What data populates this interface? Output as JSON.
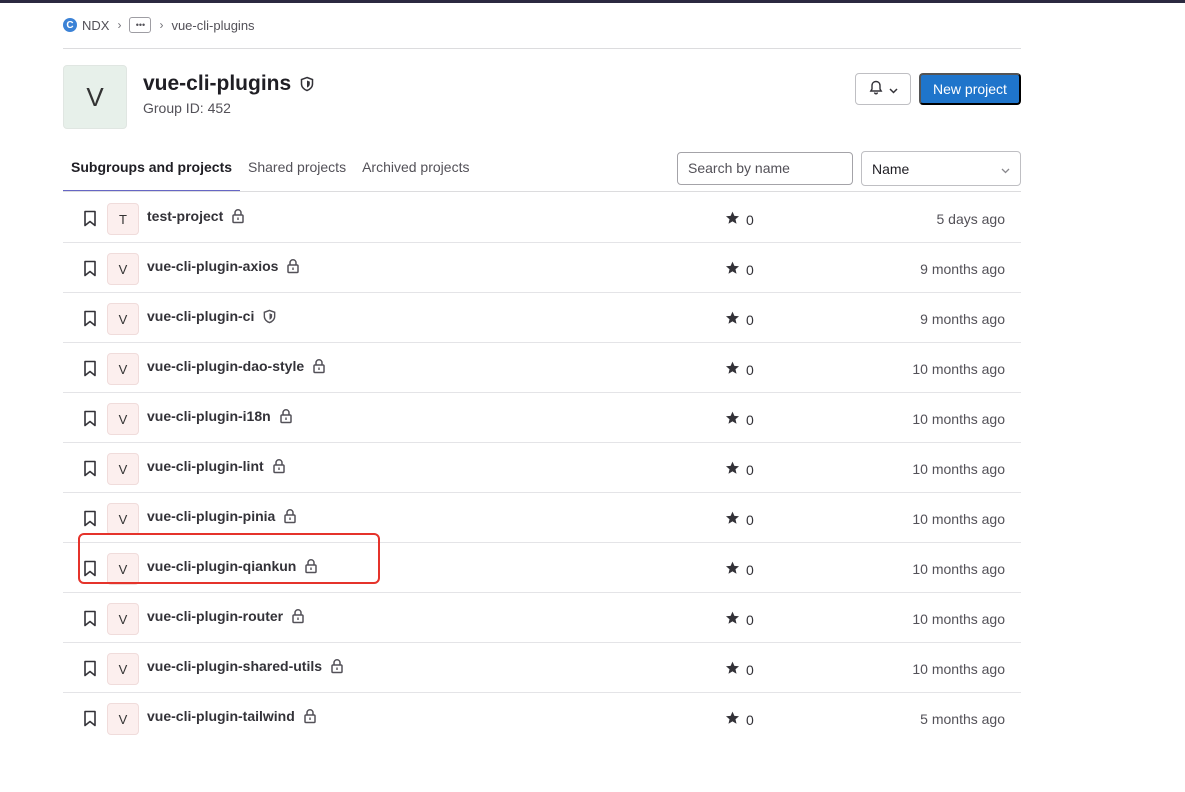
{
  "breadcrumb": {
    "root": "NDX",
    "more": "•••",
    "current": "vue-cli-plugins"
  },
  "group": {
    "avatar_letter": "V",
    "title": "vue-cli-plugins",
    "id_text": "Group ID: 452"
  },
  "actions": {
    "new_project": "New project"
  },
  "tabs": [
    {
      "label": "Subgroups and projects",
      "active": true
    },
    {
      "label": "Shared projects",
      "active": false
    },
    {
      "label": "Archived projects",
      "active": false
    }
  ],
  "search": {
    "placeholder": "Search by name"
  },
  "sort": {
    "selected": "Name"
  },
  "projects": [
    {
      "letter": "T",
      "name": "test-project",
      "visibility": "lock-icon",
      "stars": "0",
      "updated": "5 days ago"
    },
    {
      "letter": "V",
      "name": "vue-cli-plugin-axios",
      "visibility": "lock-icon",
      "stars": "0",
      "updated": "9 months ago"
    },
    {
      "letter": "V",
      "name": "vue-cli-plugin-ci",
      "visibility": "shield-icon",
      "stars": "0",
      "updated": "9 months ago"
    },
    {
      "letter": "V",
      "name": "vue-cli-plugin-dao-style",
      "visibility": "lock-icon",
      "stars": "0",
      "updated": "10 months ago"
    },
    {
      "letter": "V",
      "name": "vue-cli-plugin-i18n",
      "visibility": "lock-icon",
      "stars": "0",
      "updated": "10 months ago"
    },
    {
      "letter": "V",
      "name": "vue-cli-plugin-lint",
      "visibility": "lock-icon",
      "stars": "0",
      "updated": "10 months ago"
    },
    {
      "letter": "V",
      "name": "vue-cli-plugin-pinia",
      "visibility": "lock-icon",
      "stars": "0",
      "updated": "10 months ago"
    },
    {
      "letter": "V",
      "name": "vue-cli-plugin-qiankun",
      "visibility": "lock-icon",
      "stars": "0",
      "updated": "10 months ago"
    },
    {
      "letter": "V",
      "name": "vue-cli-plugin-router",
      "visibility": "lock-icon",
      "stars": "0",
      "updated": "10 months ago"
    },
    {
      "letter": "V",
      "name": "vue-cli-plugin-shared-utils",
      "visibility": "lock-icon",
      "stars": "0",
      "updated": "10 months ago"
    },
    {
      "letter": "V",
      "name": "vue-cli-plugin-tailwind",
      "visibility": "lock-icon",
      "stars": "0",
      "updated": "5 months ago"
    }
  ],
  "colors": {
    "primary_button": "#1f75cb",
    "active_tab_underline": "#6666c4",
    "highlight_box": "#e5332b"
  }
}
